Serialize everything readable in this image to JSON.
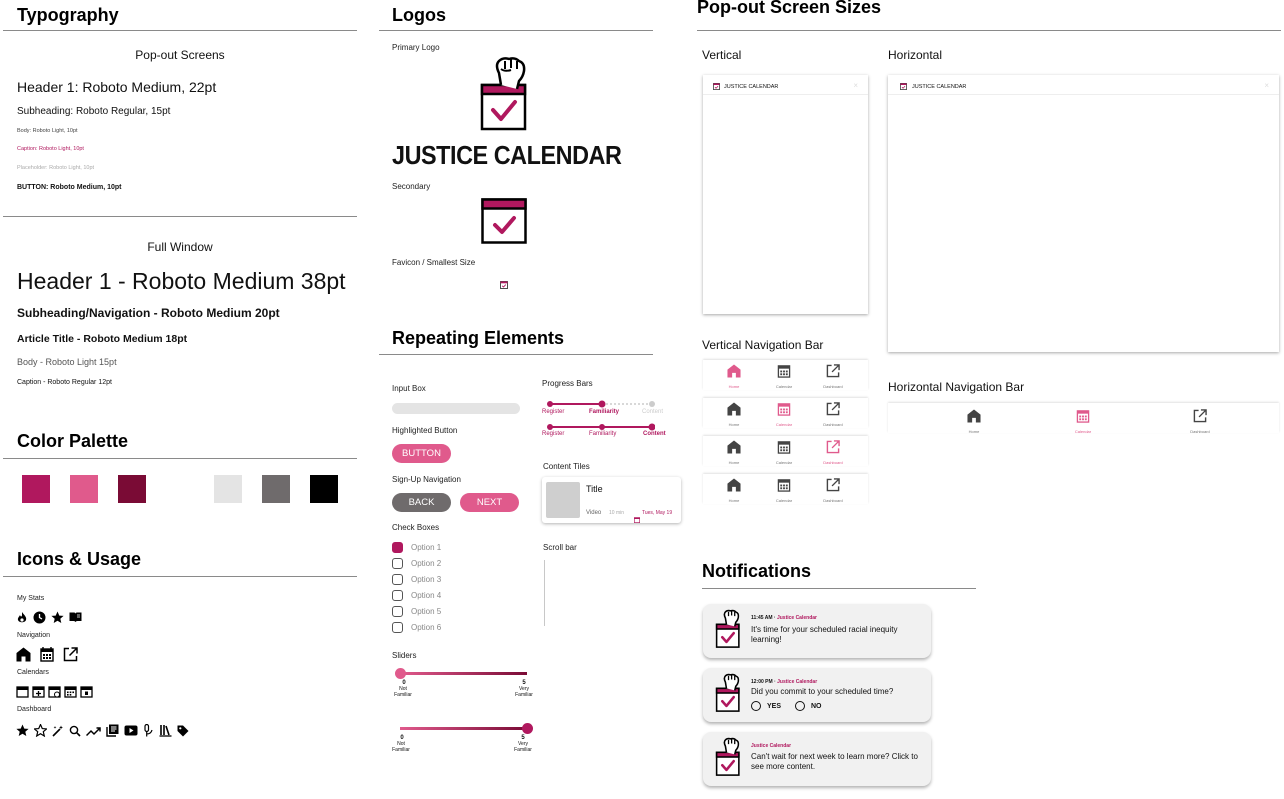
{
  "colors": {
    "primary": "#b0185e",
    "primary_light": "#e05a8c",
    "primary_dark": "#7a0b35",
    "light_gray": "#e4e4e4",
    "mid_gray": "#6f6b6c",
    "black": "#000000"
  },
  "typography": {
    "title": "Typography",
    "popout": {
      "heading": "Pop-out Screens",
      "h1": "Header 1: Roboto Medium, 22pt",
      "subheading": "Subheading: Roboto Regular, 15pt",
      "body": "Body: Roboto Light, 10pt",
      "caption": "Caption: Roboto Light, 10pt",
      "placeholder": "Placeholder: Roboto Light, 10pt",
      "button": "BUTTON: Roboto Medium, 10pt"
    },
    "full": {
      "heading": "Full Window",
      "h1": "Header 1 - Roboto Medium 38pt",
      "subheading": "Subheading/Navigation - Roboto Medium 20pt",
      "article": "Article Title - Roboto Medium 18pt",
      "body": "Body - Roboto Light 15pt",
      "caption": "Caption - Roboto Regular 12pt"
    }
  },
  "palette": {
    "title": "Color Palette"
  },
  "icons": {
    "title": "Icons & Usage",
    "my_stats": "My Stats",
    "navigation": "Navigation",
    "calendars": "Calendars",
    "dashboard": "Dashboard"
  },
  "logos": {
    "title": "Logos",
    "primary": "Primary Logo",
    "wordmark": "JUSTICE CALENDAR",
    "secondary": "Secondary",
    "favicon": "Favicon / Smallest Size"
  },
  "repeating": {
    "title": "Repeating Elements",
    "input_box": "Input Box",
    "highlighted_button": "Highlighted Button",
    "button_label": "BUTTON",
    "signup_nav": "Sign-Up Navigation",
    "back": "BACK",
    "next": "NEXT",
    "check_boxes": "Check Boxes",
    "options": [
      "Option 1",
      "Option 2",
      "Option 3",
      "Option 4",
      "Option 5",
      "Option 6"
    ],
    "sliders": "Sliders",
    "slider_min": "0",
    "slider_min_label": "Not Familiar",
    "slider_max": "5",
    "slider_max_label": "Very Familiar",
    "slider1_value": 0.0,
    "slider2_value": 1.0,
    "progress_bars": "Progress Bars",
    "progress_steps": [
      "Register",
      "Familiarity",
      "Content"
    ],
    "content_tiles": "Content Tiles",
    "tile_title": "Title",
    "tile_type": "Video",
    "tile_duration": "10 min",
    "tile_date": "Tues, May 19",
    "scroll_bar": "Scroll bar"
  },
  "popout_sizes": {
    "title": "Pop-out Screen Sizes",
    "vertical": "Vertical",
    "horizontal": "Horizontal",
    "window_title": "JUSTICE CALENDAR",
    "vertical_nav": "Vertical Navigation Bar",
    "horizontal_nav": "Horizontal Navigation Bar",
    "nav_labels": [
      "Home",
      "Calendar",
      "Dashboard"
    ]
  },
  "notifications": {
    "title": "Notifications",
    "n1_time": "11:45 AM",
    "n1_source": "Justice Calendar",
    "n1_text": "It's time for your scheduled racial inequity learning!",
    "n2_time": "12:00 PM",
    "n2_source": "Justice Calendar",
    "n2_text": "Did you commit to your scheduled time?",
    "yes": "YES",
    "no": "NO",
    "n3_source": "Justice Calendar",
    "n3_text": "Can't wait for next week to learn more? Click to see more content."
  }
}
